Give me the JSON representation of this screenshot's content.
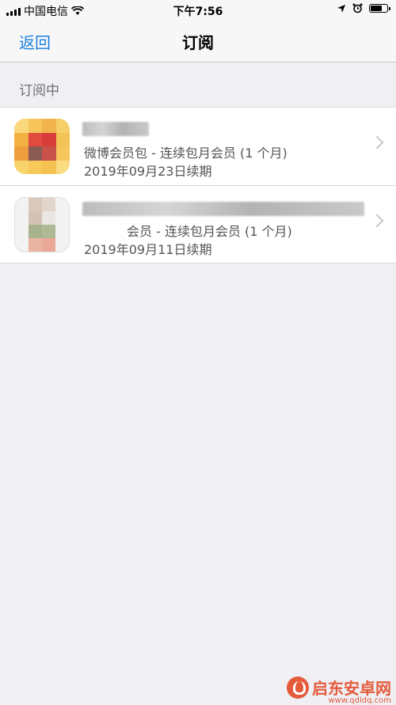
{
  "status_bar": {
    "carrier": "中国电信",
    "time": "下午7:56"
  },
  "nav": {
    "back_label": "返回",
    "title": "订阅"
  },
  "section": {
    "header": "订阅中"
  },
  "subscriptions": [
    {
      "plan": "微博会员包 - 连续包月会员 (1 个月)",
      "renewal": "2019年09月23日续期"
    },
    {
      "plan": "会员 - 连续包月会员 (1 个月)",
      "renewal": "2019年09月11日续期"
    }
  ],
  "watermark": {
    "brand": "启东安卓网",
    "url": "www.qdldq.com"
  }
}
